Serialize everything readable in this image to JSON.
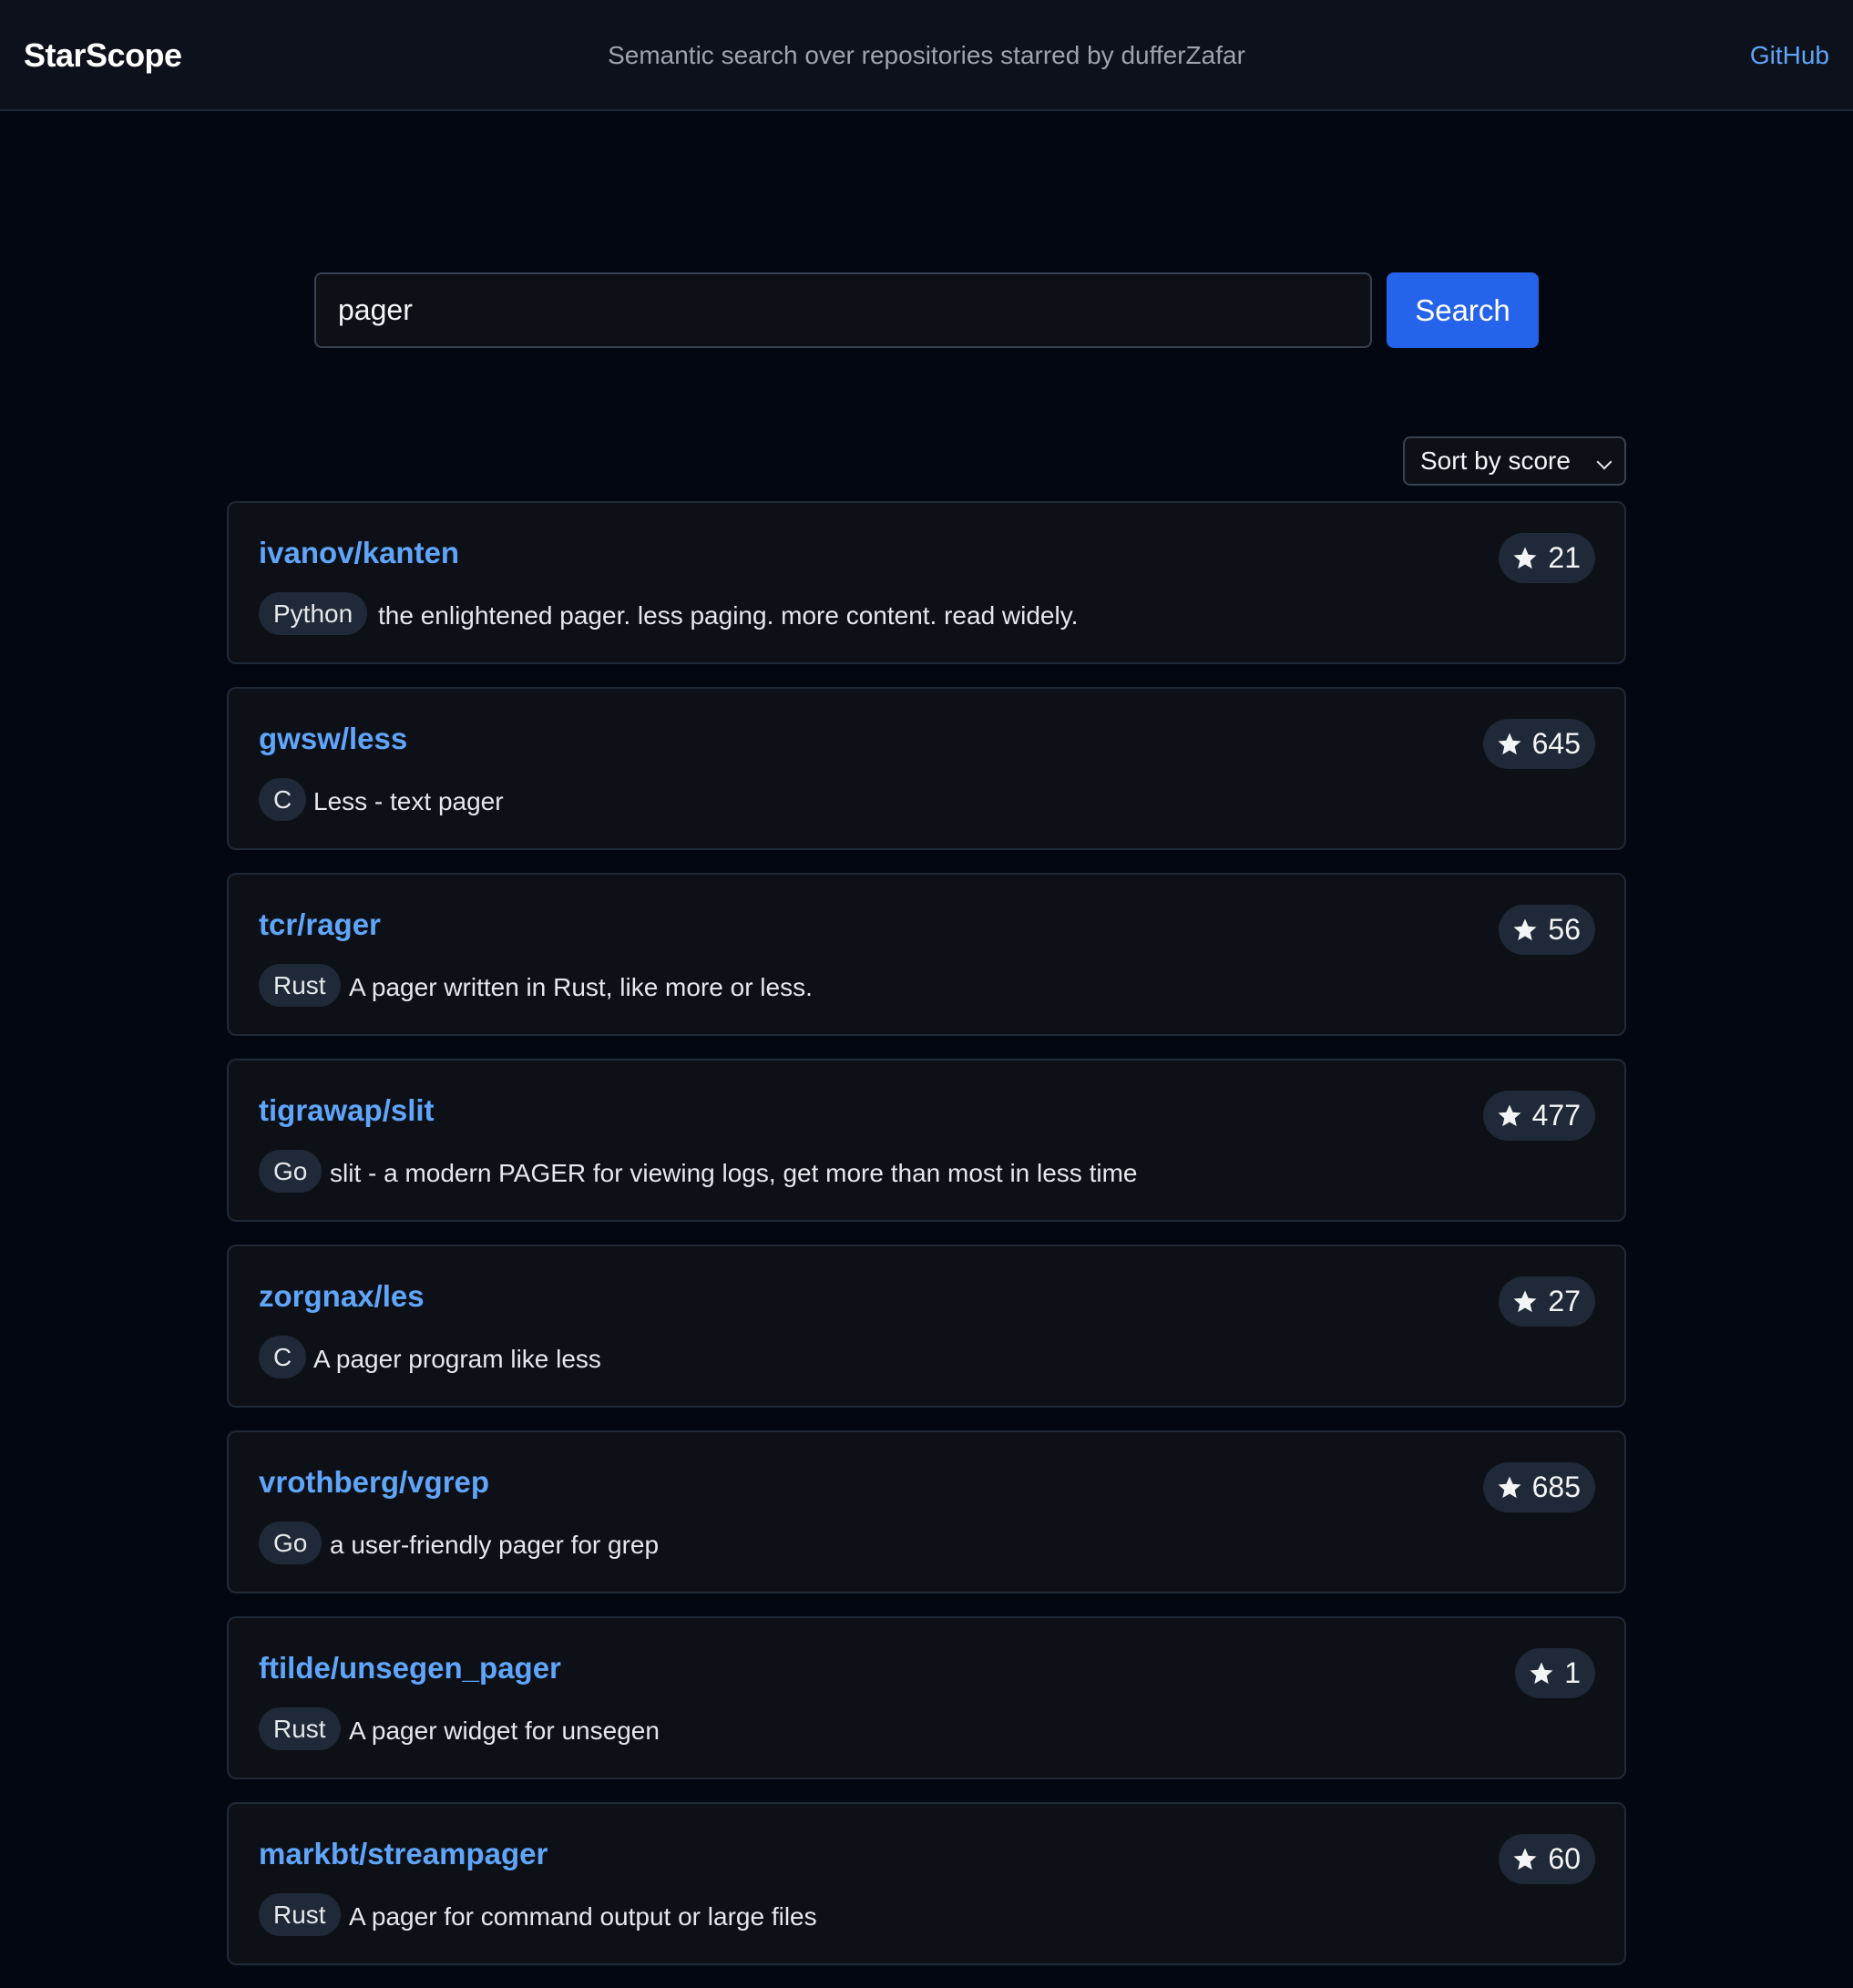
{
  "header": {
    "brand": "StarScope",
    "tagline": "Semantic search over repositories starred by dufferZafar",
    "github_link": "GitHub"
  },
  "search": {
    "value": "pager",
    "button_label": "Search"
  },
  "sort": {
    "selected": "Sort by score"
  },
  "colors": {
    "background": "#030712",
    "accent": "#2563eb",
    "link": "#60a5fa"
  },
  "results": [
    {
      "name": "ivanov/kanten",
      "language": "Python",
      "description": "the enlightened pager. less paging. more content. read widely.",
      "stars": "21"
    },
    {
      "name": "gwsw/less",
      "language": "C",
      "description": "Less - text pager",
      "stars": "645"
    },
    {
      "name": "tcr/rager",
      "language": "Rust",
      "description": "A pager written in Rust, like more or less.",
      "stars": "56"
    },
    {
      "name": "tigrawap/slit",
      "language": "Go",
      "description": "slit - a modern PAGER for viewing logs, get more than most in less time",
      "stars": "477"
    },
    {
      "name": "zorgnax/les",
      "language": "C",
      "description": "A pager program like less",
      "stars": "27"
    },
    {
      "name": "vrothberg/vgrep",
      "language": "Go",
      "description": "a user-friendly pager for grep",
      "stars": "685"
    },
    {
      "name": "ftilde/unsegen_pager",
      "language": "Rust",
      "description": "A pager widget for unsegen",
      "stars": "1"
    },
    {
      "name": "markbt/streampager",
      "language": "Rust",
      "description": "A pager for command output or large files",
      "stars": "60"
    }
  ]
}
